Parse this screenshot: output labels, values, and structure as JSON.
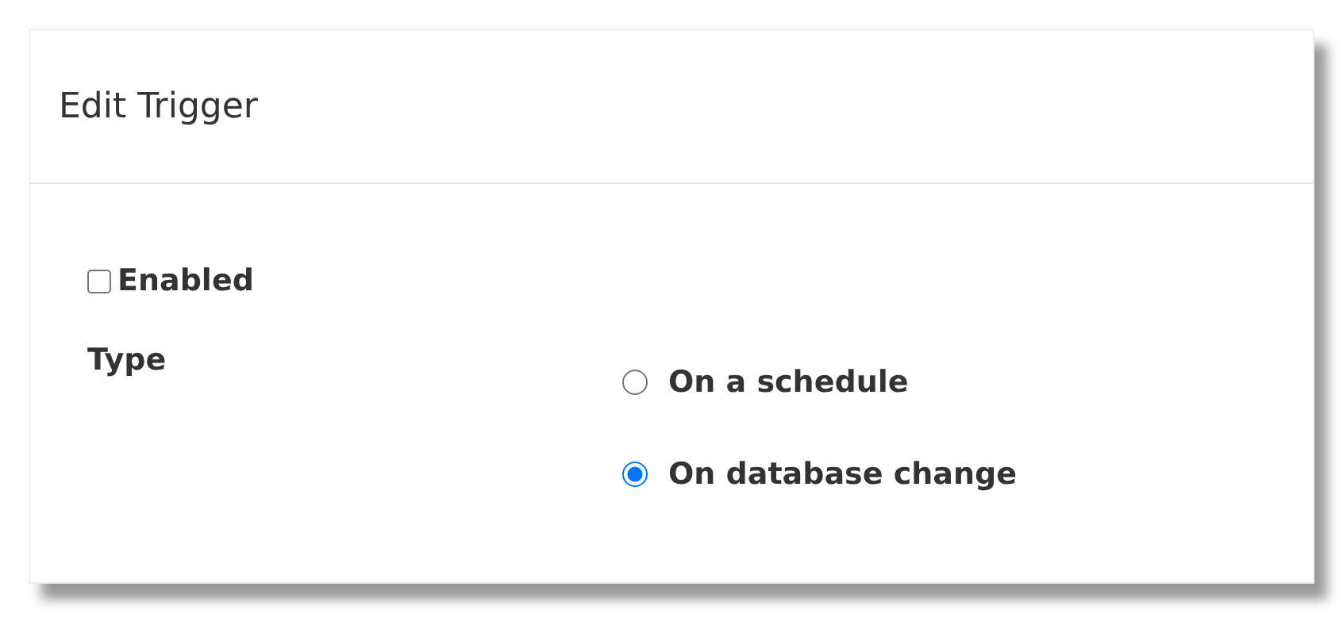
{
  "dialog": {
    "title": "Edit Trigger"
  },
  "enabled": {
    "label": "Enabled",
    "checked": false
  },
  "type": {
    "label": "Type",
    "options": [
      {
        "label": "On a schedule",
        "selected": false
      },
      {
        "label": "On database change",
        "selected": true
      }
    ]
  }
}
